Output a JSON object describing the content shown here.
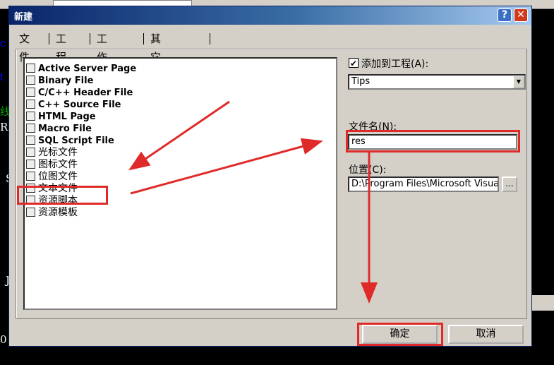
{
  "background": {
    "fragments": [
      "c",
      "t",
      "线",
      "RI",
      "S",
      "J",
      "0"
    ]
  },
  "dialog": {
    "title": "新建",
    "help_label": "?",
    "close_label": "✕",
    "tabs": [
      "文件",
      "工程",
      "工作区",
      "其它文档"
    ],
    "file_types": [
      "Active Server Page",
      "Binary File",
      "C/C++ Header File",
      "C++ Source File",
      "HTML Page",
      "Macro File",
      "SQL Script File",
      "光标文件",
      "图标文件",
      "位图文件",
      "文本文件",
      "资源脚本",
      "资源模板"
    ],
    "add_to_project": {
      "label": "添加到工程(A):",
      "checked": true,
      "check_mark": "✔"
    },
    "project_select": {
      "value": "Tips",
      "arrow": "▼"
    },
    "filename": {
      "label": "文件名(N):",
      "value": "res"
    },
    "location": {
      "label": "位置(C):",
      "value": "D:\\Program Files\\Microsoft Visua",
      "browse_label": "..."
    },
    "ok_label": "确定",
    "cancel_label": "取消"
  },
  "annotation_color": "#e02a2a"
}
